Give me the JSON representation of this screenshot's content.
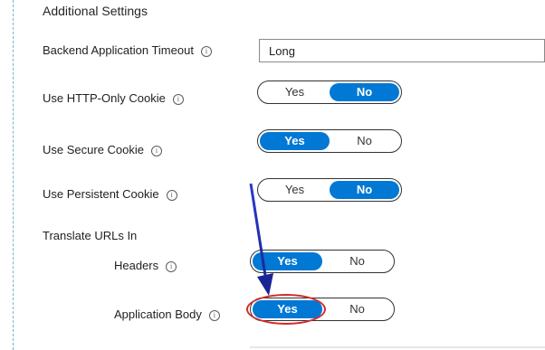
{
  "section": {
    "title": "Additional Settings"
  },
  "timeout": {
    "label": "Backend Application Timeout",
    "value": "Long"
  },
  "toggles": [
    {
      "label": "Use HTTP-Only Cookie",
      "yes": "Yes",
      "no": "No",
      "selected": "No"
    },
    {
      "label": "Use Secure Cookie",
      "yes": "Yes",
      "no": "No",
      "selected": "Yes"
    },
    {
      "label": "Use Persistent Cookie",
      "yes": "Yes",
      "no": "No",
      "selected": "No"
    }
  ],
  "translate": {
    "label": "Translate URLs In",
    "headers": {
      "label": "Headers",
      "yes": "Yes",
      "no": "No",
      "selected": "Yes"
    },
    "body": {
      "label": "Application Body",
      "yes": "Yes",
      "no": "No",
      "selected": "Yes"
    }
  },
  "info_icon": {
    "glyph": "i"
  },
  "colors": {
    "accent": "#0078d4",
    "annotation_arrow": "#1f2fbf",
    "annotation_ring": "#d42a2a"
  }
}
